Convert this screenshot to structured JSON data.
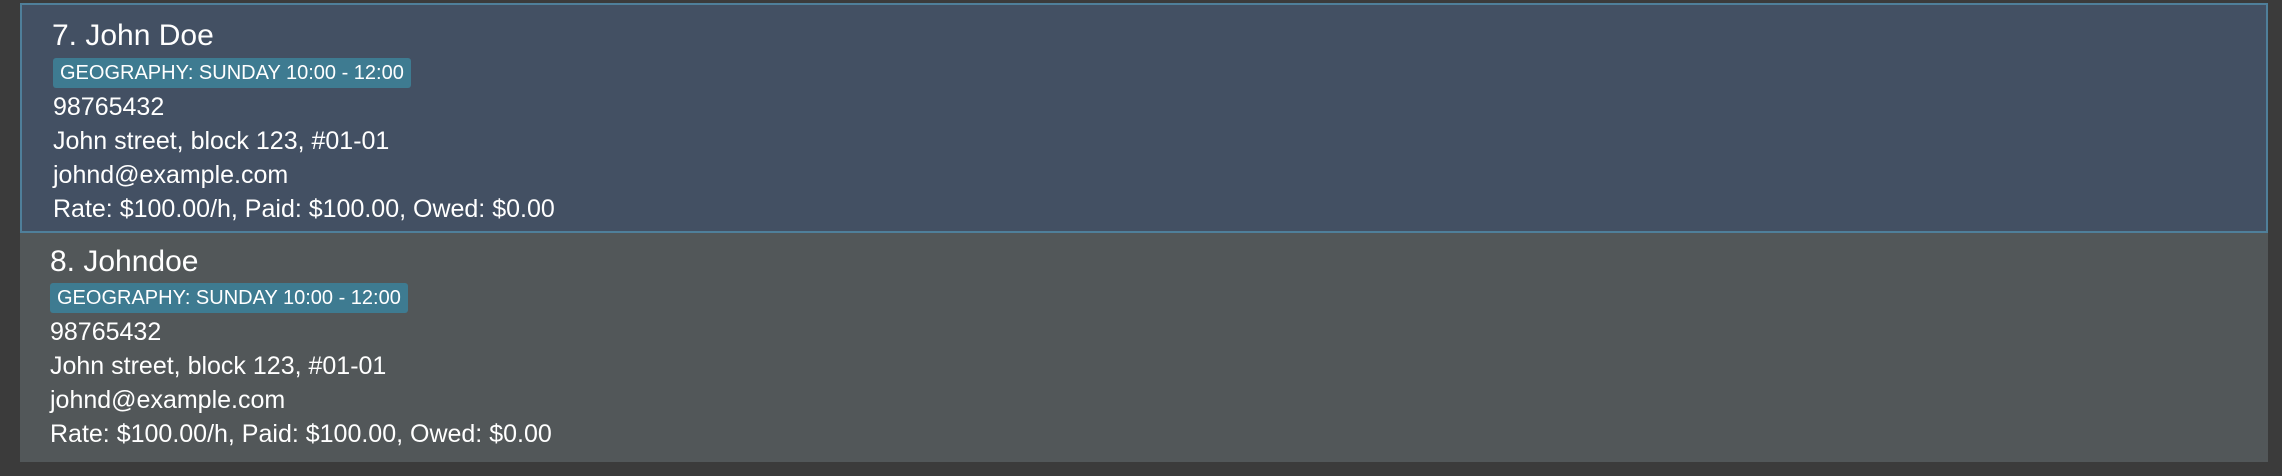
{
  "persons": [
    {
      "index_name": "7. John Doe",
      "tag": "GEOGRAPHY: SUNDAY 10:00 - 12:00",
      "phone": "98765432",
      "address": "John street, block 123, #01-01",
      "email": "johnd@example.com",
      "rate_line": "Rate: $100.00/h, Paid: $100.00, Owed: $0.00",
      "selected": true
    },
    {
      "index_name": "8. Johndoe",
      "tag": "GEOGRAPHY: SUNDAY 10:00 - 12:00",
      "phone": "98765432",
      "address": "John street, block 123, #01-01",
      "email": "johnd@example.com",
      "rate_line": "Rate: $100.00/h, Paid: $100.00, Owed: $0.00",
      "selected": false
    }
  ],
  "colors": {
    "background": "#3b3b3b",
    "selected_card": "#435063",
    "selected_border": "#4f7f9a",
    "card": "#525759",
    "tag": "#3e7b91",
    "text": "#ffffff"
  }
}
